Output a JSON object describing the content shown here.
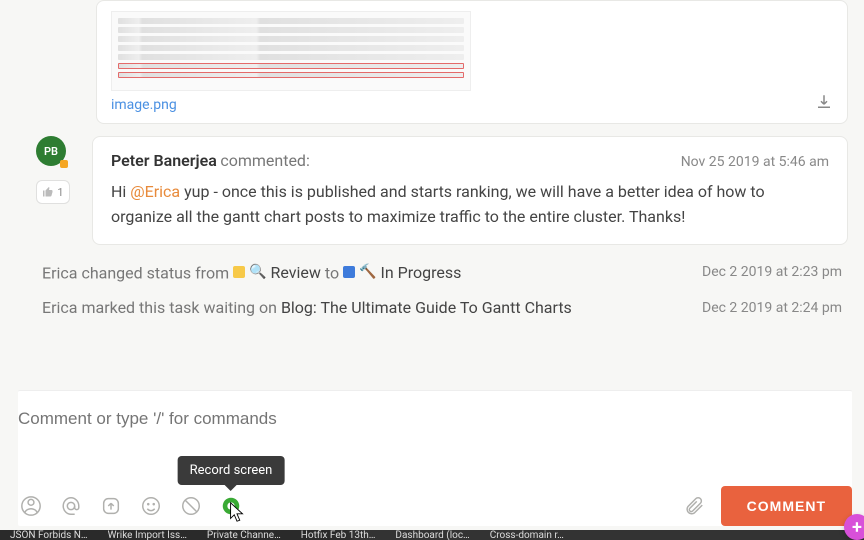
{
  "attachment": {
    "filename": "image.png"
  },
  "comment": {
    "avatar_initials": "PB",
    "author": "Peter Banerjea",
    "action_label": "commented:",
    "body_prefix": "Hi ",
    "mention": "@Erica",
    "body_suffix": " yup - once this is published and starts ranking, we will have a better idea of how to organize all the gantt chart posts to maximize traffic to the entire cluster. Thanks!",
    "timestamp": "Nov 25 2019 at 5:46 am",
    "like_count": "1"
  },
  "activity": {
    "status_change": {
      "actor": "Erica",
      "verb": "changed status from",
      "from_label": "Review",
      "to_word": "to",
      "to_label": "In Progress",
      "timestamp": "Dec 2 2019 at 2:23 pm"
    },
    "waiting_on": {
      "actor": "Erica",
      "verb": "marked this task waiting on",
      "target": "Blog: The Ultimate Guide To Gantt Charts",
      "timestamp": "Dec 2 2019 at 2:24 pm"
    }
  },
  "composer": {
    "placeholder": "Comment or type '/' for commands",
    "submit_label": "COMMENT",
    "tooltip": "Record screen"
  },
  "bottombar": {
    "items": [
      "JSON Forbids N…",
      "Wrike Import Iss…",
      "Private Channe…",
      "Hotfix Feb 13th…",
      "Dashboard (loc…",
      "Cross-domain r…"
    ]
  }
}
